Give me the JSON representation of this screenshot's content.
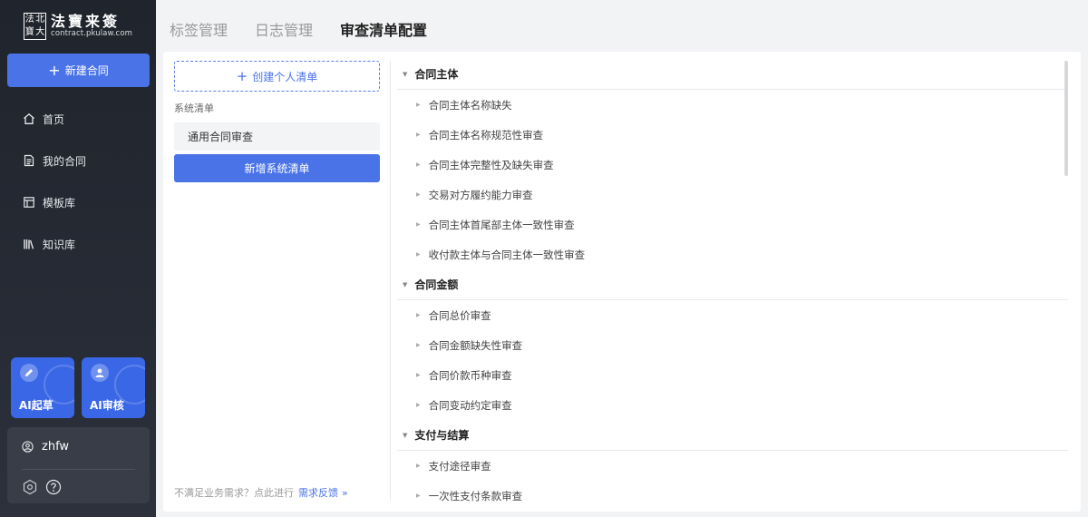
{
  "logo": {
    "seal_chars": [
      "法",
      "北",
      "寶",
      "大"
    ],
    "brand": "法寶来簽",
    "url": "contract.pkulaw.com"
  },
  "sidebar": {
    "new_button_label": "新建合同",
    "nav": [
      {
        "label": "首页",
        "icon": "home-icon"
      },
      {
        "label": "我的合同",
        "icon": "document-icon"
      },
      {
        "label": "模板库",
        "icon": "template-icon"
      },
      {
        "label": "知识库",
        "icon": "books-icon"
      }
    ],
    "ai_cards": [
      {
        "label": "AI起草",
        "icon": "pen-icon"
      },
      {
        "label": "AI审核",
        "icon": "person-icon"
      }
    ],
    "user": {
      "name": "zhfw"
    }
  },
  "tabs": [
    {
      "label": "标签管理",
      "active": false
    },
    {
      "label": "日志管理",
      "active": false
    },
    {
      "label": "审查清单配置",
      "active": true
    }
  ],
  "left_panel": {
    "create_button_label": "创建个人清单",
    "system_list_label": "系统清单",
    "system_items": [
      "通用合同审查"
    ],
    "add_system_button_label": "新增系统清单",
    "feedback_text": "不满足业务需求？点此进行",
    "feedback_link": "需求反馈"
  },
  "checklist": [
    {
      "group": "合同主体",
      "items": [
        "合同主体名称缺失",
        "合同主体名称规范性审查",
        "合同主体完整性及缺失审查",
        "交易对方履约能力审查",
        "合同主体首尾部主体一致性审查",
        "收付款主体与合同主体一致性审查"
      ]
    },
    {
      "group": "合同金额",
      "items": [
        "合同总价审查",
        "合同金额缺失性审查",
        "合同价款币种审查",
        "合同变动约定审查"
      ]
    },
    {
      "group": "支付与结算",
      "items": [
        "支付途径审查",
        "一次性支付条款审查"
      ]
    }
  ],
  "colors": {
    "primary": "#4a73e8",
    "sidebar_bg": "#232730"
  }
}
